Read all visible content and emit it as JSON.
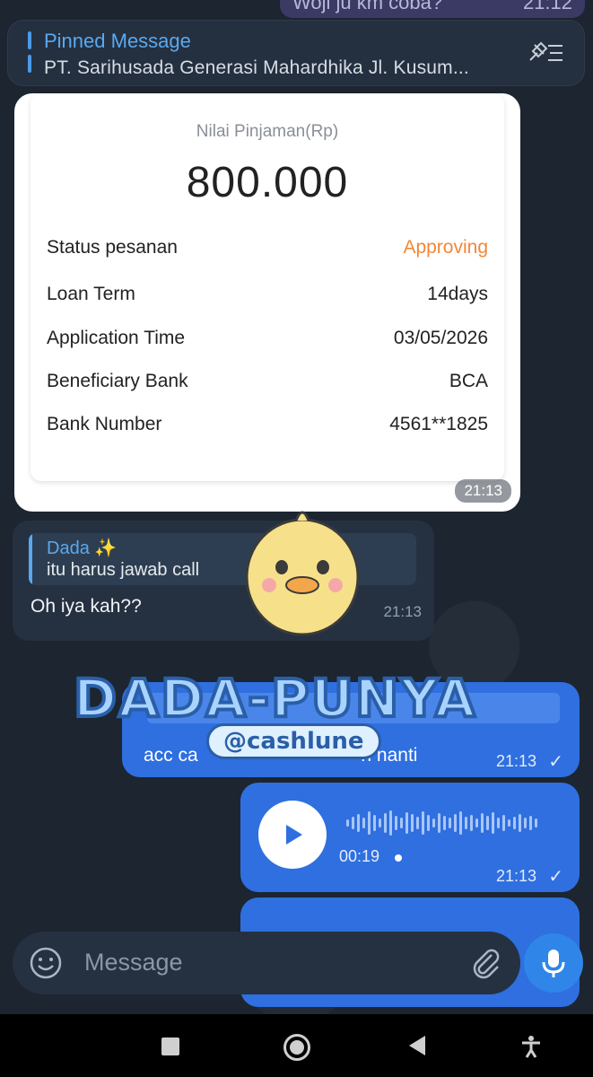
{
  "previous_message": {
    "text": "Woji ju km coba?",
    "time": "21:12"
  },
  "pinned": {
    "title": "Pinned Message",
    "text": "PT. Sarihusada Generasi Mahardhika Jl. Kusum..."
  },
  "loan_card": {
    "label": "Nilai Pinjaman(Rp)",
    "amount": "800.000",
    "rows": [
      {
        "label": "Status pesanan",
        "value": "Approving"
      },
      {
        "label": "Loan Term",
        "value": "14days"
      },
      {
        "label": "Application Time",
        "value": "03/05/2026"
      },
      {
        "label": "Beneficiary Bank",
        "value": "BCA"
      },
      {
        "label": "Bank Number",
        "value": "4561**1825"
      }
    ],
    "time": "21:13",
    "status_color": "#f0883a"
  },
  "incoming_message": {
    "reply_name": "Dada ✨",
    "reply_text": "itu harus jawab call",
    "text": "Oh iya kah??",
    "time": "21:13"
  },
  "outgoing_text": {
    "text": "acc ca",
    "text_tail": "n nanti",
    "time": "21:13",
    "status": "✓"
  },
  "outgoing_voice": {
    "duration": "00:19",
    "time": "21:13",
    "status": "✓"
  },
  "composer": {
    "placeholder": "Message"
  },
  "watermark": {
    "title": "DADA-PUNYA",
    "handle": "@cashlune"
  },
  "colors": {
    "outgoing_bubble": "#2f6fe0",
    "incoming_bubble": "#253141",
    "accent": "#5aa9ee"
  }
}
